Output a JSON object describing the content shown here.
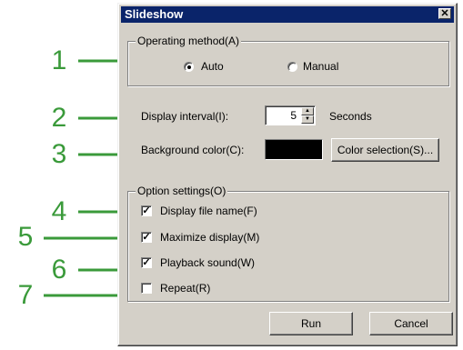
{
  "accent_color": "#3a9a3a",
  "dialog": {
    "title": "Slideshow",
    "close_glyph": "✕"
  },
  "operating_method": {
    "legend": "Operating method(A)",
    "options": [
      {
        "label": "Auto",
        "selected": true
      },
      {
        "label": "Manual",
        "selected": false
      }
    ]
  },
  "display_interval": {
    "label": "Display interval(I):",
    "value": "5",
    "unit": "Seconds"
  },
  "background_color": {
    "label": "Background color(C):",
    "swatch": "#000000",
    "button_label": "Color selection(S)..."
  },
  "option_settings": {
    "legend": "Option settings(O)",
    "options": [
      {
        "label": "Display file name(F)",
        "checked": true
      },
      {
        "label": "Maximize display(M)",
        "checked": true
      },
      {
        "label": "Playback sound(W)",
        "checked": true
      },
      {
        "label": "Repeat(R)",
        "checked": false
      }
    ]
  },
  "buttons": {
    "run": "Run",
    "cancel": "Cancel"
  },
  "callouts": [
    "1",
    "2",
    "3",
    "4",
    "5",
    "6",
    "7"
  ]
}
